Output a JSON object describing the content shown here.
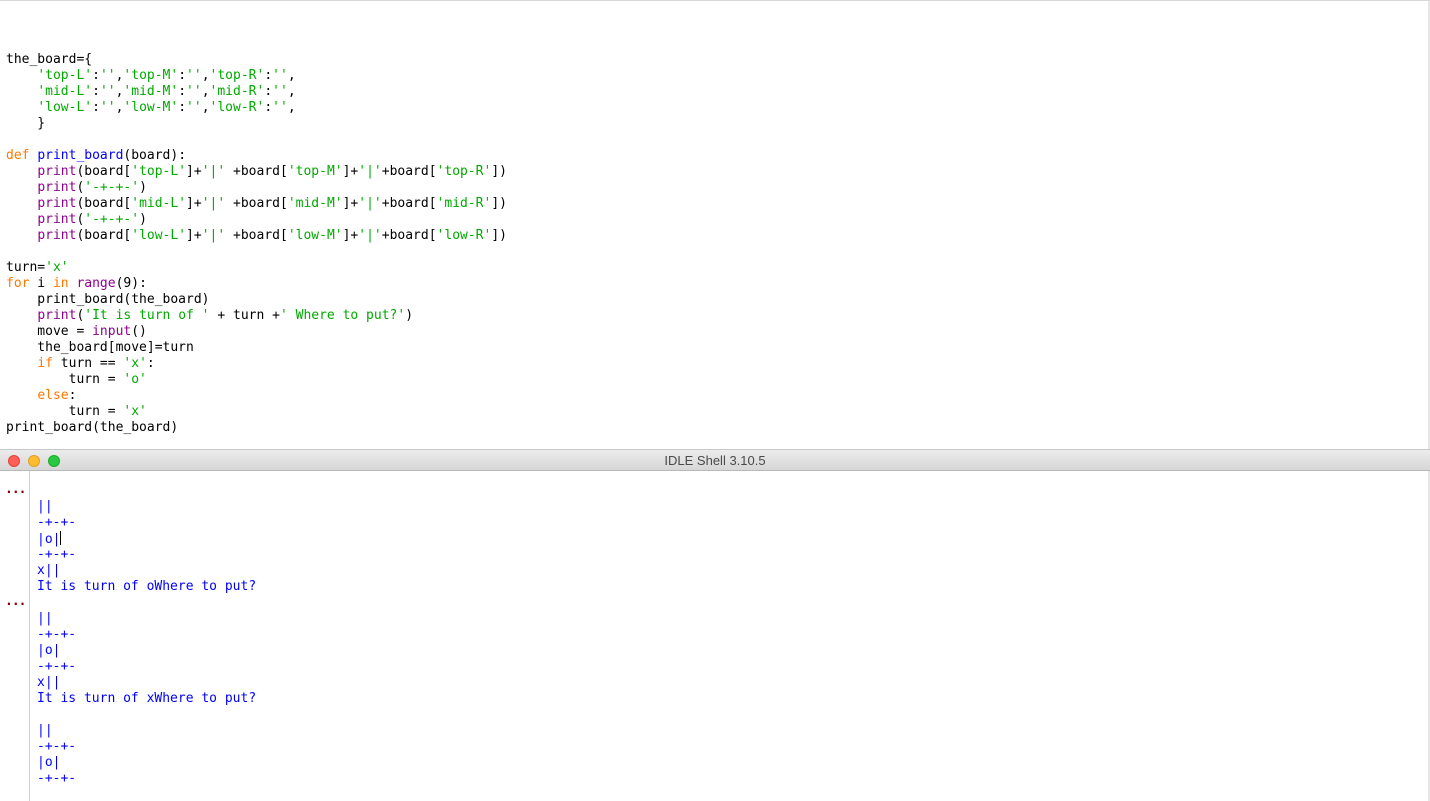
{
  "editor": {
    "lines": [
      [
        {
          "t": "the_board={",
          "c": ""
        }
      ],
      [
        {
          "t": "    ",
          "c": ""
        },
        {
          "t": "'top-L'",
          "c": "str"
        },
        {
          "t": ":",
          "c": ""
        },
        {
          "t": "''",
          "c": "str"
        },
        {
          "t": ",",
          "c": ""
        },
        {
          "t": "'top-M'",
          "c": "str"
        },
        {
          "t": ":",
          "c": ""
        },
        {
          "t": "''",
          "c": "str"
        },
        {
          "t": ",",
          "c": ""
        },
        {
          "t": "'top-R'",
          "c": "str"
        },
        {
          "t": ":",
          "c": ""
        },
        {
          "t": "''",
          "c": "str"
        },
        {
          "t": ",",
          "c": ""
        }
      ],
      [
        {
          "t": "    ",
          "c": ""
        },
        {
          "t": "'mid-L'",
          "c": "str"
        },
        {
          "t": ":",
          "c": ""
        },
        {
          "t": "''",
          "c": "str"
        },
        {
          "t": ",",
          "c": ""
        },
        {
          "t": "'mid-M'",
          "c": "str"
        },
        {
          "t": ":",
          "c": ""
        },
        {
          "t": "''",
          "c": "str"
        },
        {
          "t": ",",
          "c": ""
        },
        {
          "t": "'mid-R'",
          "c": "str"
        },
        {
          "t": ":",
          "c": ""
        },
        {
          "t": "''",
          "c": "str"
        },
        {
          "t": ",",
          "c": ""
        }
      ],
      [
        {
          "t": "    ",
          "c": ""
        },
        {
          "t": "'low-L'",
          "c": "str"
        },
        {
          "t": ":",
          "c": ""
        },
        {
          "t": "''",
          "c": "str"
        },
        {
          "t": ",",
          "c": ""
        },
        {
          "t": "'low-M'",
          "c": "str"
        },
        {
          "t": ":",
          "c": ""
        },
        {
          "t": "''",
          "c": "str"
        },
        {
          "t": ",",
          "c": ""
        },
        {
          "t": "'low-R'",
          "c": "str"
        },
        {
          "t": ":",
          "c": ""
        },
        {
          "t": "''",
          "c": "str"
        },
        {
          "t": ",",
          "c": ""
        }
      ],
      [
        {
          "t": "    }",
          "c": ""
        }
      ],
      [
        {
          "t": "",
          "c": ""
        }
      ],
      [
        {
          "t": "def",
          "c": "kw"
        },
        {
          "t": " ",
          "c": ""
        },
        {
          "t": "print_board",
          "c": "def"
        },
        {
          "t": "(board):",
          "c": ""
        }
      ],
      [
        {
          "t": "    ",
          "c": ""
        },
        {
          "t": "print",
          "c": "bi"
        },
        {
          "t": "(board[",
          "c": ""
        },
        {
          "t": "'top-L'",
          "c": "str"
        },
        {
          "t": "]+",
          "c": ""
        },
        {
          "t": "'|'",
          "c": "str"
        },
        {
          "t": " +board[",
          "c": ""
        },
        {
          "t": "'top-M'",
          "c": "str"
        },
        {
          "t": "]+",
          "c": ""
        },
        {
          "t": "'|'",
          "c": "str"
        },
        {
          "t": "+board[",
          "c": ""
        },
        {
          "t": "'top-R'",
          "c": "str"
        },
        {
          "t": "])",
          "c": ""
        }
      ],
      [
        {
          "t": "    ",
          "c": ""
        },
        {
          "t": "print",
          "c": "bi"
        },
        {
          "t": "(",
          "c": ""
        },
        {
          "t": "'-+-+-'",
          "c": "str"
        },
        {
          "t": ")",
          "c": ""
        }
      ],
      [
        {
          "t": "    ",
          "c": ""
        },
        {
          "t": "print",
          "c": "bi"
        },
        {
          "t": "(board[",
          "c": ""
        },
        {
          "t": "'mid-L'",
          "c": "str"
        },
        {
          "t": "]+",
          "c": ""
        },
        {
          "t": "'|'",
          "c": "str"
        },
        {
          "t": " +board[",
          "c": ""
        },
        {
          "t": "'mid-M'",
          "c": "str"
        },
        {
          "t": "]+",
          "c": ""
        },
        {
          "t": "'|'",
          "c": "str"
        },
        {
          "t": "+board[",
          "c": ""
        },
        {
          "t": "'mid-R'",
          "c": "str"
        },
        {
          "t": "])",
          "c": ""
        }
      ],
      [
        {
          "t": "    ",
          "c": ""
        },
        {
          "t": "print",
          "c": "bi"
        },
        {
          "t": "(",
          "c": ""
        },
        {
          "t": "'-+-+-'",
          "c": "str"
        },
        {
          "t": ")",
          "c": ""
        }
      ],
      [
        {
          "t": "    ",
          "c": ""
        },
        {
          "t": "print",
          "c": "bi"
        },
        {
          "t": "(board[",
          "c": ""
        },
        {
          "t": "'low-L'",
          "c": "str"
        },
        {
          "t": "]+",
          "c": ""
        },
        {
          "t": "'|'",
          "c": "str"
        },
        {
          "t": " +board[",
          "c": ""
        },
        {
          "t": "'low-M'",
          "c": "str"
        },
        {
          "t": "]+",
          "c": ""
        },
        {
          "t": "'|'",
          "c": "str"
        },
        {
          "t": "+board[",
          "c": ""
        },
        {
          "t": "'low-R'",
          "c": "str"
        },
        {
          "t": "])",
          "c": ""
        }
      ],
      [
        {
          "t": "",
          "c": ""
        }
      ],
      [
        {
          "t": "turn=",
          "c": ""
        },
        {
          "t": "'x'",
          "c": "str"
        }
      ],
      [
        {
          "t": "for",
          "c": "kw"
        },
        {
          "t": " i ",
          "c": ""
        },
        {
          "t": "in",
          "c": "kw"
        },
        {
          "t": " ",
          "c": ""
        },
        {
          "t": "range",
          "c": "bi"
        },
        {
          "t": "(9):",
          "c": ""
        }
      ],
      [
        {
          "t": "    print_board(the_board)",
          "c": ""
        }
      ],
      [
        {
          "t": "    ",
          "c": ""
        },
        {
          "t": "print",
          "c": "bi"
        },
        {
          "t": "(",
          "c": ""
        },
        {
          "t": "'It is turn of '",
          "c": "str"
        },
        {
          "t": " + turn +",
          "c": ""
        },
        {
          "t": "' Where to put?'",
          "c": "str"
        },
        {
          "t": ")",
          "c": ""
        }
      ],
      [
        {
          "t": "    move = ",
          "c": ""
        },
        {
          "t": "input",
          "c": "bi"
        },
        {
          "t": "()",
          "c": ""
        }
      ],
      [
        {
          "t": "    the_board[move]=turn",
          "c": ""
        }
      ],
      [
        {
          "t": "    ",
          "c": ""
        },
        {
          "t": "if",
          "c": "kw"
        },
        {
          "t": " turn == ",
          "c": ""
        },
        {
          "t": "'x'",
          "c": "str"
        },
        {
          "t": ":",
          "c": ""
        }
      ],
      [
        {
          "t": "        turn = ",
          "c": ""
        },
        {
          "t": "'o'",
          "c": "str"
        }
      ],
      [
        {
          "t": "    ",
          "c": ""
        },
        {
          "t": "else",
          "c": "kw"
        },
        {
          "t": ":",
          "c": ""
        }
      ],
      [
        {
          "t": "        turn = ",
          "c": ""
        },
        {
          "t": "'x'",
          "c": "str"
        }
      ],
      [
        {
          "t": "print_board(the_board)",
          "c": ""
        }
      ]
    ]
  },
  "shell": {
    "title": "IDLE Shell 3.10.5",
    "prompt": "...",
    "output_lines": [
      "||",
      "-+-+-",
      "|o|",
      "-+-+-",
      "x||",
      "It is turn of oWhere to put?",
      "",
      "||",
      "-+-+-",
      "|o|",
      "-+-+-",
      "x||",
      "It is turn of xWhere to put?",
      "",
      "||",
      "-+-+-",
      "|o|",
      "-+-+-"
    ]
  },
  "colors": {
    "keyword": "#ff7700",
    "string": "#00aa00",
    "builtin": "#900090",
    "definition": "#0000ff",
    "shell_output": "#0000ff",
    "prompt": "#8b0000"
  }
}
